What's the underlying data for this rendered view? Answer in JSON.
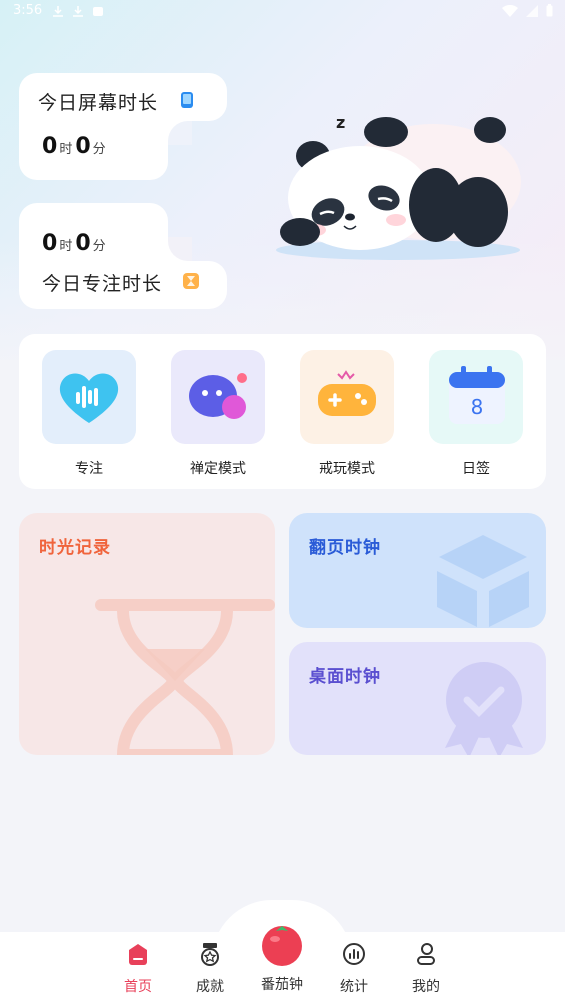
{
  "status_bar": {
    "time": "3:56"
  },
  "screen_time": {
    "label": "今日屏幕时长",
    "hours": "0",
    "hour_unit": "时",
    "minutes": "0",
    "minute_unit": "分"
  },
  "focus_time": {
    "label": "今日专注时长",
    "hours": "0",
    "hour_unit": "时",
    "minutes": "0",
    "minute_unit": "分"
  },
  "mascot": {
    "sleep_text": "z"
  },
  "features": [
    {
      "label": "专注",
      "icon": "heart-pulse-icon"
    },
    {
      "label": "禅定模式",
      "icon": "chat-bubbles-icon"
    },
    {
      "label": "戒玩模式",
      "icon": "gamepad-icon"
    },
    {
      "label": "日签",
      "icon": "calendar-icon",
      "day": "8"
    }
  ],
  "tiles": {
    "time_record": {
      "title": "时光记录",
      "color": "#f0643c"
    },
    "flip_clock": {
      "title": "翻页时钟",
      "color": "#2a5bd7"
    },
    "desktop_clock": {
      "title": "桌面时钟",
      "color": "#5a4fd0"
    }
  },
  "nav": [
    {
      "label": "首页",
      "icon": "home-icon",
      "active": true
    },
    {
      "label": "成就",
      "icon": "medal-icon",
      "active": false
    },
    {
      "label": "番茄钟",
      "icon": "tomato-icon",
      "active": false
    },
    {
      "label": "统计",
      "icon": "chart-icon",
      "active": false
    },
    {
      "label": "我的",
      "icon": "profile-icon",
      "active": false
    }
  ],
  "colors": {
    "accent": "#e8405a",
    "background": "#f3f4f9"
  }
}
